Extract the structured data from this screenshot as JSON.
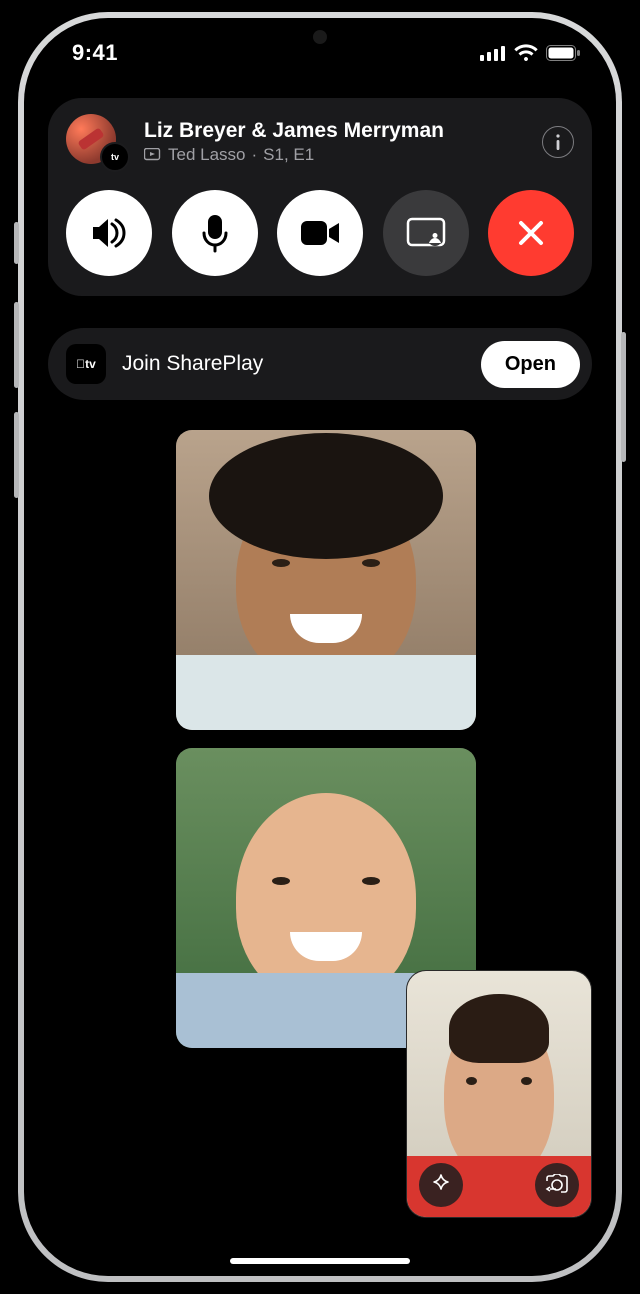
{
  "status": {
    "time": "9:41"
  },
  "call": {
    "participants_title": "Liz Breyer & James Merryman",
    "shareplay_icon_label": "tv",
    "now_playing_title": "Ted Lasso",
    "now_playing_detail": "S1, E1"
  },
  "shareplay_banner": {
    "app_label": "tv",
    "prompt": "Join SharePlay",
    "action": "Open"
  },
  "pip": {
    "effects_label": "effects",
    "flip_label": "flip"
  }
}
